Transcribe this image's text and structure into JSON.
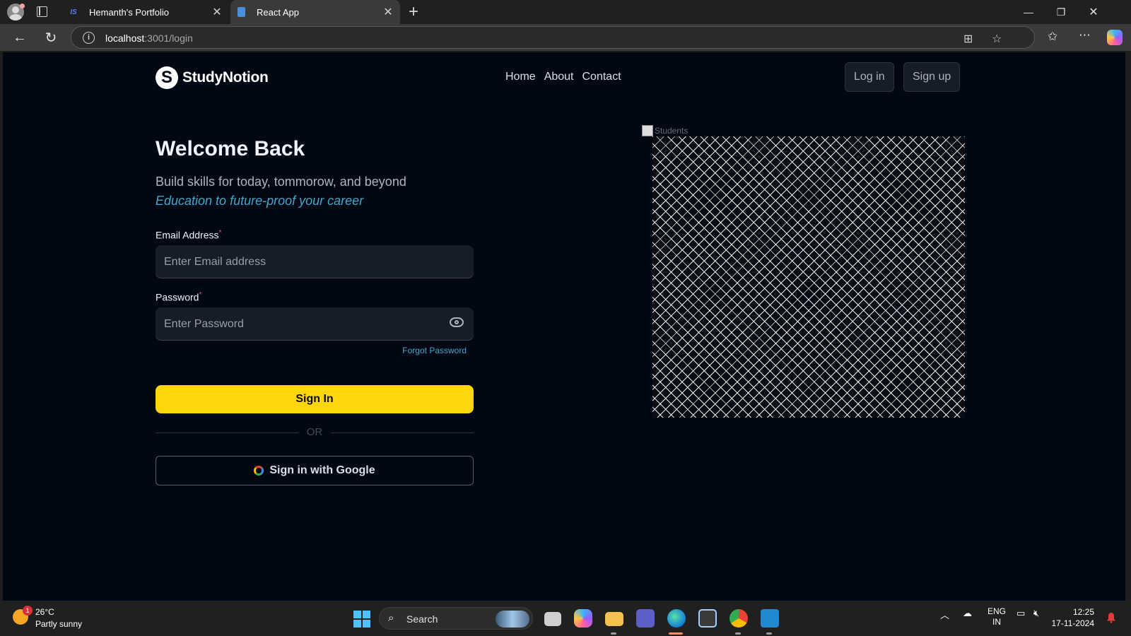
{
  "browser": {
    "tabs": [
      {
        "title": "Hemanth's Portfolio",
        "favicon": "IS"
      },
      {
        "title": "React App",
        "favicon": "document-icon"
      }
    ],
    "url_host": "localhost",
    "url_rest": ":3001/login"
  },
  "nav": {
    "brand": "StudyNotion",
    "brand_logo_letter": "S",
    "links": [
      "Home",
      "About",
      "Contact"
    ],
    "login_label": "Log in",
    "signup_label": "Sign up"
  },
  "login": {
    "heading": "Welcome Back",
    "subtitle": "Build skills for today, tommorow, and beyond",
    "tagline": "Education to future-proof your career",
    "email_label": "Email Address",
    "email_placeholder": "Enter Email address",
    "password_label": "Password",
    "password_placeholder": "Enter Password",
    "required_mark": "*",
    "forgot": "Forgot Password",
    "signin_label": "Sign In",
    "or_text": "OR",
    "google_label": "Sign in with Google"
  },
  "hero_image": {
    "alt": "Students"
  },
  "taskbar": {
    "temperature": "26°C",
    "condition": "Partly sunny",
    "weather_badge": "1",
    "search_label": "Search",
    "lang_line1": "ENG",
    "lang_line2": "IN",
    "time": "12:25",
    "date": "17-11-2024"
  },
  "colors": {
    "page_bg": "#000814",
    "accent_yellow": "#ffd60a",
    "link_blue": "#47a5c5",
    "required_pink": "#ef476f"
  }
}
